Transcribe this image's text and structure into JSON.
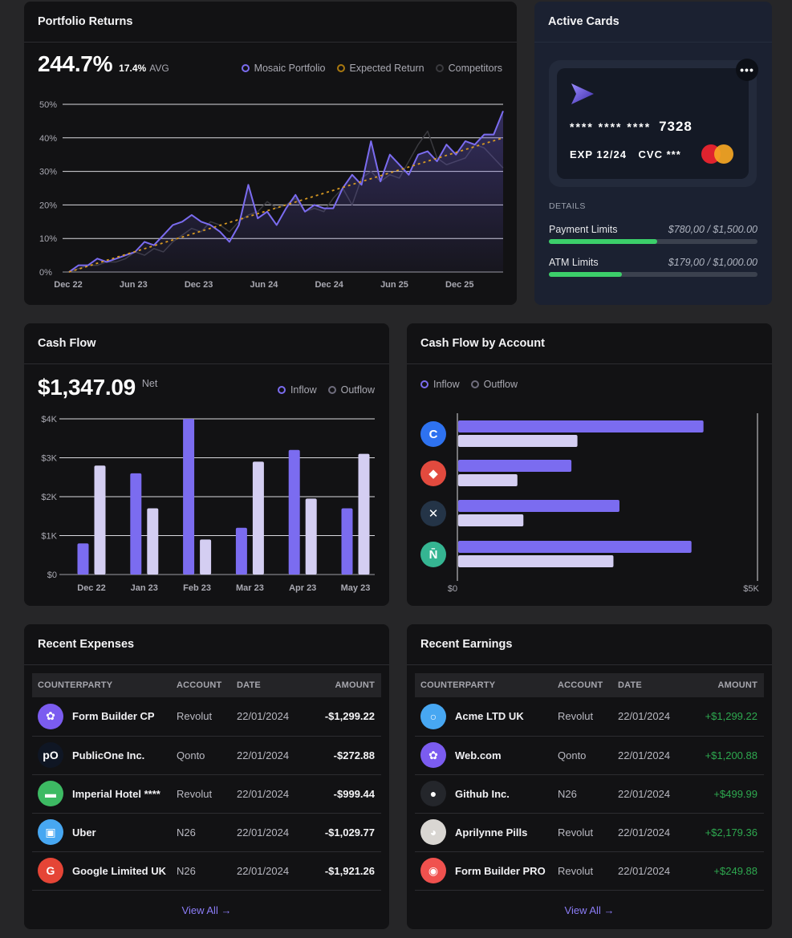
{
  "portfolio": {
    "title": "Portfolio Returns",
    "value": "244.7%",
    "avg_value": "17.4%",
    "avg_label": "AVG",
    "legend": [
      {
        "label": "Mosaic Portfolio",
        "color": "#7b6cf0"
      },
      {
        "label": "Expected Return",
        "color": "#d89a22"
      },
      {
        "label": "Competitors",
        "color": "#3a3a3e"
      }
    ]
  },
  "active_cards": {
    "title": "Active Cards",
    "more_label": "•••",
    "card_mask": "**** **** ****",
    "card_last4": "7328",
    "exp": "EXP 12/24",
    "cvc": "CVC ***",
    "details_label": "DETAILS",
    "limits": [
      {
        "label": "Payment Limits",
        "amount": "$780,00 / $1,500.00",
        "ratio": 0.52
      },
      {
        "label": "ATM Limits",
        "amount": "$179,00 / $1,000.00",
        "ratio": 0.35
      }
    ]
  },
  "cash_flow": {
    "title": "Cash Flow",
    "value": "$1,347.09",
    "value_suffix": "Net",
    "legend": [
      {
        "label": "Inflow",
        "color": "#7b6cf0"
      },
      {
        "label": "Outflow",
        "color": "#b9b4d6"
      }
    ]
  },
  "cash_flow_by_account": {
    "title": "Cash Flow by Account",
    "legend": [
      {
        "label": "Inflow",
        "color": "#7b6cf0"
      },
      {
        "label": "Outflow",
        "color": "#b9b4d6"
      }
    ],
    "accounts": [
      {
        "icon": "coinbase-icon",
        "color": "#2e72f0",
        "glyph": "C"
      },
      {
        "icon": "hsbc-icon",
        "color": "#e24a3e",
        "glyph": "◆"
      },
      {
        "icon": "x-bank-icon",
        "color": "#243447",
        "glyph": "✕"
      },
      {
        "icon": "n26-icon",
        "color": "#35b592",
        "glyph": "N̄"
      }
    ]
  },
  "recent_expenses": {
    "title": "Recent Expenses",
    "columns": [
      "COUNTERPARTY",
      "ACCOUNT",
      "DATE",
      "AMOUNT"
    ],
    "rows": [
      {
        "name": "Form Builder CP",
        "account": "Revolut",
        "date": "22/01/2024",
        "amount": "-$1,299.22",
        "icon": "form-builder-icon",
        "color": "#7b5cf0",
        "glyph": "✿"
      },
      {
        "name": "PublicOne Inc.",
        "account": "Qonto",
        "date": "22/01/2024",
        "amount": "-$272.88",
        "icon": "publicone-icon",
        "color": "#0f1624",
        "glyph": "pO"
      },
      {
        "name": "Imperial Hotel ****",
        "account": "Revolut",
        "date": "22/01/2024",
        "amount": "-$999.44",
        "icon": "hotel-bed-icon",
        "color": "#3dba63",
        "glyph": "▬"
      },
      {
        "name": "Uber",
        "account": "N26",
        "date": "22/01/2024",
        "amount": "-$1,029.77",
        "icon": "uber-icon",
        "color": "#47a7f2",
        "glyph": "▣"
      },
      {
        "name": "Google Limited UK",
        "account": "N26",
        "date": "22/01/2024",
        "amount": "-$1,921.26",
        "icon": "google-icon",
        "color": "#e54536",
        "glyph": "G"
      }
    ],
    "view_all": "View All →"
  },
  "recent_earnings": {
    "title": "Recent Earnings",
    "columns": [
      "COUNTERPARTY",
      "ACCOUNT",
      "DATE",
      "AMOUNT"
    ],
    "rows": [
      {
        "name": "Acme LTD UK",
        "account": "Revolut",
        "date": "22/01/2024",
        "amount": "+$1,299.22",
        "icon": "acme-icon",
        "color": "#47a7f2",
        "glyph": "○"
      },
      {
        "name": "Web.com",
        "account": "Qonto",
        "date": "22/01/2024",
        "amount": "+$1,200.88",
        "icon": "web-com-icon",
        "color": "#7b5cf0",
        "glyph": "✿"
      },
      {
        "name": "Github Inc.",
        "account": "N26",
        "date": "22/01/2024",
        "amount": "+$499.99",
        "icon": "github-icon",
        "color": "#24262b",
        "glyph": "●"
      },
      {
        "name": "Aprilynne Pills",
        "account": "Revolut",
        "date": "22/01/2024",
        "amount": "+$2,179.36",
        "icon": "avatar-photo-icon",
        "color": "#d9d6d2",
        "glyph": "◕"
      },
      {
        "name": "Form Builder PRO",
        "account": "Revolut",
        "date": "22/01/2024",
        "amount": "+$249.88",
        "icon": "form-builder-pro-icon",
        "color": "#f0514e",
        "glyph": "◉"
      }
    ],
    "view_all": "View All →"
  },
  "chart_data": [
    {
      "type": "line",
      "title": "Portfolio Returns",
      "x": [
        "Dec 22",
        "Jun 23",
        "Dec 23",
        "Jun 24",
        "Dec 24",
        "Jun 25",
        "Dec 25"
      ],
      "ylim": [
        0,
        50
      ],
      "yticks": [
        "0%",
        "10%",
        "20%",
        "30%",
        "40%",
        "50%"
      ],
      "grid": true,
      "series": [
        {
          "name": "Mosaic Portfolio",
          "values": [
            0,
            2,
            2,
            4,
            3,
            4,
            5,
            6,
            9,
            8,
            11,
            14,
            15,
            17,
            15,
            14,
            12,
            9,
            14,
            26,
            16,
            18,
            14,
            19,
            23,
            18,
            20,
            19,
            19,
            25,
            29,
            26,
            39,
            27,
            35,
            32,
            29,
            35,
            36,
            33,
            38,
            35,
            39,
            38,
            41,
            41,
            48
          ]
        },
        {
          "name": "Expected Return",
          "values": [
            0,
            40
          ]
        },
        {
          "name": "Competitors",
          "values": [
            0,
            1,
            2,
            2,
            3,
            3,
            4,
            6,
            5,
            7,
            6,
            9,
            11,
            13,
            12,
            15,
            14,
            12,
            15,
            17,
            18,
            21,
            19,
            20,
            22,
            18,
            19,
            18,
            22,
            25,
            20,
            28,
            30,
            27,
            29,
            28,
            33,
            38,
            42,
            34,
            32,
            33,
            34,
            38,
            37,
            34,
            31
          ]
        }
      ]
    },
    {
      "type": "bar",
      "title": "Cash Flow",
      "categories": [
        "Dec 22",
        "Jan 23",
        "Feb 23",
        "Mar 23",
        "Apr 23",
        "May 23"
      ],
      "ylim": [
        0,
        4000
      ],
      "yticks": [
        "$0",
        "$1K",
        "$2K",
        "$3K",
        "$4K"
      ],
      "grid": true,
      "series": [
        {
          "name": "Inflow",
          "values": [
            800,
            2600,
            4000,
            1200,
            3200,
            1700
          ]
        },
        {
          "name": "Outflow",
          "values": [
            2800,
            1700,
            900,
            2900,
            1950,
            3100
          ]
        }
      ]
    },
    {
      "type": "bar",
      "orientation": "horizontal",
      "title": "Cash Flow by Account",
      "xlim": [
        0,
        5000
      ],
      "xticks": [
        "$0",
        "$5K"
      ],
      "series": [
        {
          "name": "Inflow",
          "values": [
            4100,
            1900,
            2700,
            3900
          ]
        },
        {
          "name": "Outflow",
          "values": [
            2000,
            1000,
            1100,
            2600
          ]
        }
      ]
    }
  ]
}
